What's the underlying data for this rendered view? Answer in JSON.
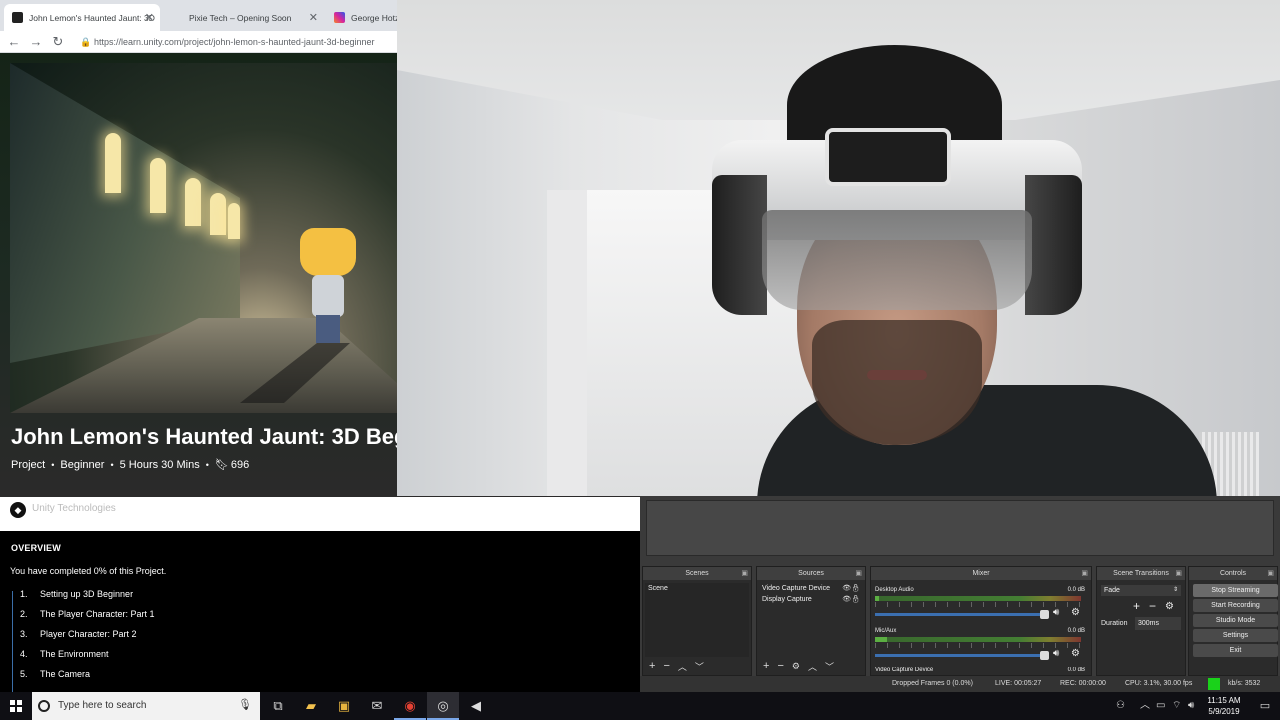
{
  "browser": {
    "tabs": [
      {
        "label": "John Lemon's Haunted Jaunt: 3D",
        "favicon_color": "#222222",
        "active": true
      },
      {
        "label": "Pixie Tech – Opening Soon",
        "favicon_color": "#dee1e6",
        "active": false
      },
      {
        "label": "George Hotz",
        "favicon_color": "#d6249f",
        "active": false
      }
    ],
    "url": "https://learn.unity.com/project/john-lemon-s-haunted-jaunt-3d-beginner"
  },
  "page": {
    "title": "John Lemon's Haunted Jaunt: 3D Beg",
    "meta": {
      "type": "Project",
      "level": "Beginner",
      "duration": "5 Hours 30 Mins",
      "bookmarks": "696"
    },
    "author": "Unity Technologies",
    "overview": {
      "heading": "OVERVIEW",
      "progress": "You have completed 0% of this Project.",
      "lessons": [
        {
          "num": "1.",
          "title": "Setting up 3D Beginner"
        },
        {
          "num": "2.",
          "title": "The Player Character: Part 1"
        },
        {
          "num": "3.",
          "title": "Player Character: Part 2"
        },
        {
          "num": "4.",
          "title": "The Environment"
        },
        {
          "num": "5.",
          "title": "The Camera"
        }
      ]
    }
  },
  "obs": {
    "docks": {
      "scenes": "Scenes",
      "sources": "Sources",
      "mixer": "Mixer",
      "transitions": "Scene Transitions",
      "controls": "Controls"
    },
    "scenes": [
      "Scene"
    ],
    "sources": [
      "Video Capture Device",
      "Display Capture"
    ],
    "mixer": [
      {
        "name": "Desktop Audio",
        "db": "0.0 dB",
        "level": 0.02
      },
      {
        "name": "Mic/Aux",
        "db": "0.0 dB",
        "level": 0.06
      },
      {
        "name": "Video Capture Device",
        "db": "0.0 dB",
        "level": 0.0
      }
    ],
    "transition": {
      "type": "Fade",
      "duration_label": "Duration",
      "duration": "300ms"
    },
    "controls": [
      "Stop Streaming",
      "Start Recording",
      "Studio Mode",
      "Settings",
      "Exit"
    ],
    "status": {
      "dropped": "Dropped Frames 0 (0.0%)",
      "live": "LIVE: 00:05:27",
      "rec": "REC: 00:00:00",
      "cpu": "CPU: 3.1%, 30.00 fps",
      "kbps": "kb/s: 3532",
      "live_color": "#1ad21a"
    }
  },
  "taskbar": {
    "search_placeholder": "Type here to search",
    "time": "11:15 AM",
    "date": "5/9/2019"
  }
}
